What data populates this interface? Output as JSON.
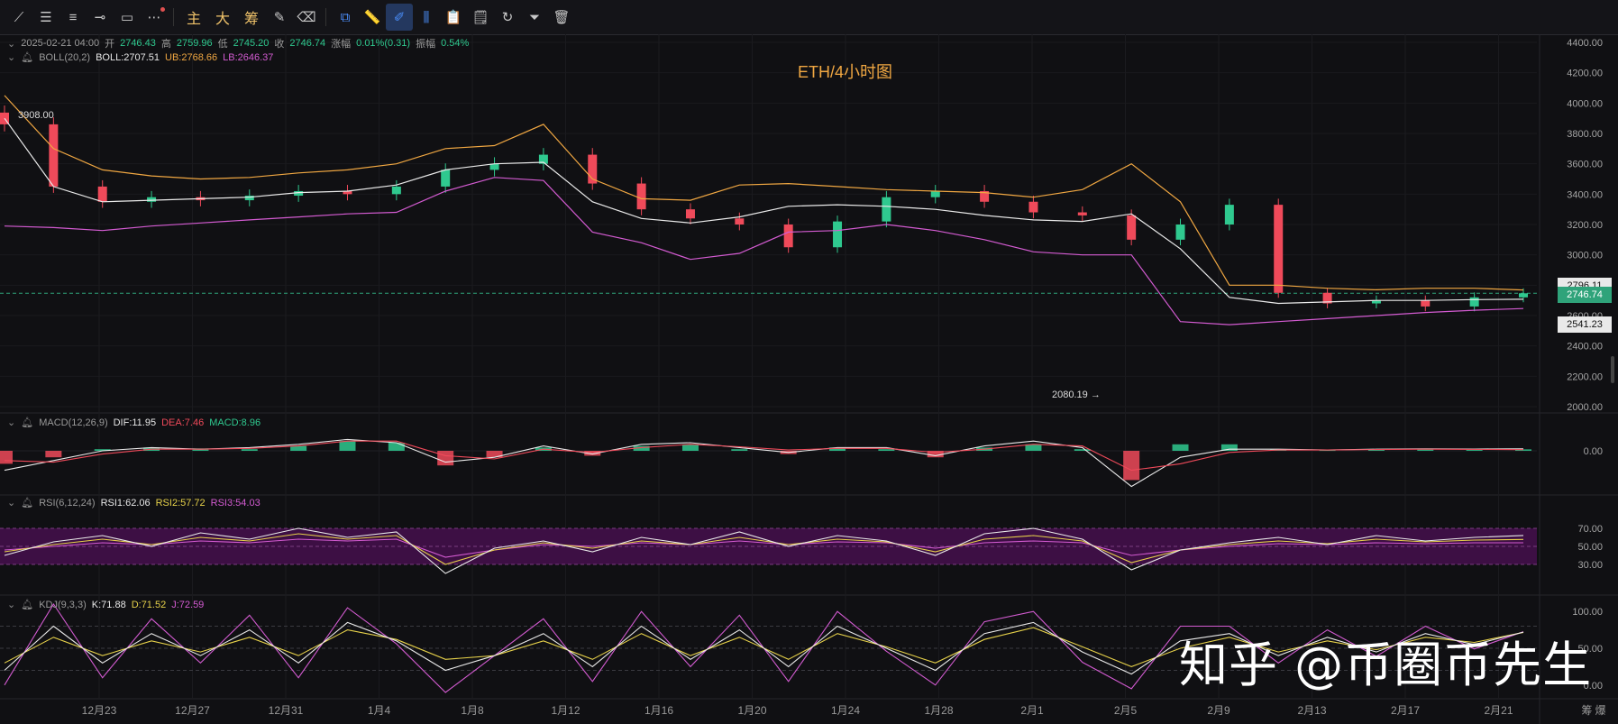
{
  "toolbar": {
    "tools": [
      {
        "name": "trend-line-tool",
        "glyph": "⟋"
      },
      {
        "name": "horizontal-lines-tool",
        "glyph": "☰"
      },
      {
        "name": "parallel-lines-tool",
        "glyph": "≡"
      },
      {
        "name": "horizontal-ray-tool",
        "glyph": "⊸"
      },
      {
        "name": "rectangle-tool",
        "glyph": "▭"
      },
      {
        "name": "more-tools",
        "glyph": "⋯"
      }
    ],
    "cn_buttons": [
      "主",
      "大",
      "筹"
    ],
    "right_tools": [
      {
        "name": "brush-tool",
        "glyph": "✎"
      },
      {
        "name": "eraser-tool",
        "glyph": "⌫"
      },
      {
        "name": "copy-tool",
        "glyph": "⧉"
      },
      {
        "name": "ruler-tool",
        "glyph": "📏"
      },
      {
        "name": "pen-tool",
        "glyph": "✐"
      },
      {
        "name": "candles-tool",
        "glyph": "⫼"
      },
      {
        "name": "clipboard-tool",
        "glyph": "📋"
      },
      {
        "name": "note-tool",
        "glyph": "🗒"
      },
      {
        "name": "replay-tool",
        "glyph": "↻"
      },
      {
        "name": "filter-tool",
        "glyph": "⏷"
      },
      {
        "name": "trash-tool",
        "glyph": "🗑"
      }
    ]
  },
  "ohlc": {
    "datetime": "2025-02-21 04:00",
    "open_label": "开",
    "open": "2746.43",
    "high_label": "高",
    "high": "2759.96",
    "low_label": "低",
    "low": "2745.20",
    "close_label": "收",
    "close": "2746.74",
    "chg_label": "涨幅",
    "chg": "0.01%(0.31)",
    "amp_label": "振幅",
    "amp": "0.54%"
  },
  "boll": {
    "label": "BOLL(20,2)",
    "mid": "BOLL:2707.51",
    "ub": "UB:2768.66",
    "lb": "LB:2646.37"
  },
  "title": "ETH/4小时图",
  "macd_legend": {
    "label": "MACD(12,26,9)",
    "dif": "DIF:11.95",
    "dea": "DEA:7.46",
    "macd": "MACD:8.96"
  },
  "rsi_legend": {
    "label": "RSI(6,12,24)",
    "rsi1": "RSI1:62.06",
    "rsi2": "RSI2:57.72",
    "rsi3": "RSI3:54.03"
  },
  "kdj_legend": {
    "label": "KDJ(9,3,3)",
    "k": "K:71.88",
    "d": "D:71.52",
    "j": "J:72.59"
  },
  "price_tags": {
    "upper": "2796.11",
    "current": "2746.74",
    "lower": "2541.23"
  },
  "annotations": {
    "high": "3908.00",
    "low": "2080.19 →"
  },
  "axis_footer": "筹  爆",
  "watermark": "知乎 @币圈币先生",
  "colors": {
    "up": "#2fc98f",
    "down": "#ef4a5a",
    "ub": "#f0a742",
    "mid": "#eaeaea",
    "lb": "#d35bd1",
    "rsi_band": "#3d0f44"
  },
  "chart_data": [
    {
      "type": "line",
      "name": "price",
      "title": "ETH/4小时图",
      "x_ticks": [
        "12月23",
        "12月27",
        "12月31",
        "1月4",
        "1月8",
        "1月12",
        "1月16",
        "1月20",
        "1月24",
        "1月28",
        "2月1",
        "2月5",
        "2月9",
        "2月13",
        "2月17",
        "2月21"
      ],
      "y_ticks": [
        "4400.00",
        "4200.00",
        "4000.00",
        "3800.00",
        "3600.00",
        "3400.00",
        "3200.00",
        "3000.00",
        "2800.00",
        "2600.00",
        "2400.00",
        "2200.00",
        "2000.00"
      ],
      "ylim": [
        2000,
        4400
      ],
      "x": [
        0,
        2,
        4,
        6,
        8,
        10,
        12,
        14,
        16,
        18,
        20,
        22,
        24,
        26,
        28,
        30,
        32,
        34,
        36,
        38,
        40,
        42,
        44,
        46,
        48,
        50,
        52,
        54,
        56,
        58,
        60,
        62
      ],
      "close": [
        3860,
        3450,
        3350,
        3380,
        3360,
        3390,
        3420,
        3400,
        3450,
        3560,
        3600,
        3660,
        3470,
        3300,
        3240,
        3200,
        3050,
        3220,
        3380,
        3420,
        3350,
        3280,
        3260,
        3100,
        3200,
        3330,
        2750,
        2680,
        2700,
        2660,
        2720,
        2746.74
      ],
      "ub": [
        4050,
        3700,
        3560,
        3520,
        3500,
        3510,
        3540,
        3560,
        3600,
        3700,
        3720,
        3860,
        3500,
        3370,
        3360,
        3460,
        3470,
        3450,
        3430,
        3420,
        3410,
        3380,
        3430,
        3600,
        3350,
        2800,
        2800,
        2780,
        2770,
        2780,
        2780,
        2768.66
      ],
      "mid": [
        3900,
        3450,
        3350,
        3360,
        3370,
        3380,
        3410,
        3420,
        3460,
        3560,
        3600,
        3610,
        3350,
        3240,
        3210,
        3250,
        3320,
        3330,
        3320,
        3300,
        3260,
        3230,
        3220,
        3270,
        3040,
        2720,
        2680,
        2690,
        2700,
        2700,
        2705,
        2707.51
      ],
      "lb": [
        3190,
        3180,
        3160,
        3190,
        3210,
        3230,
        3250,
        3270,
        3280,
        3420,
        3510,
        3490,
        3150,
        3080,
        2970,
        3010,
        3150,
        3160,
        3200,
        3160,
        3100,
        3020,
        3000,
        3000,
        2560,
        2540,
        2560,
        2580,
        2600,
        2620,
        2635,
        2646.37
      ],
      "annotations": [
        "3908.00",
        "2080.19"
      ]
    },
    {
      "type": "bar",
      "name": "MACD(12,26,9)",
      "y_ticks": [
        "0.00"
      ],
      "values": [
        -80,
        -40,
        10,
        20,
        15,
        10,
        30,
        60,
        50,
        -90,
        -40,
        20,
        -30,
        30,
        40,
        10,
        -20,
        20,
        10,
        -40,
        20,
        40,
        10,
        -180,
        40,
        40,
        10,
        5,
        10,
        12,
        8,
        8.96
      ],
      "dif": [
        -120,
        -60,
        0,
        20,
        10,
        20,
        40,
        70,
        50,
        -70,
        -40,
        30,
        -20,
        40,
        50,
        20,
        -10,
        20,
        20,
        -30,
        30,
        60,
        20,
        -220,
        -40,
        10,
        10,
        5,
        10,
        12,
        11,
        11.95
      ],
      "dea": [
        -60,
        -70,
        -20,
        10,
        10,
        15,
        30,
        60,
        60,
        -30,
        -50,
        10,
        -10,
        20,
        40,
        25,
        5,
        15,
        15,
        -10,
        10,
        40,
        30,
        -120,
        -80,
        -10,
        5,
        5,
        8,
        10,
        9,
        7.46
      ],
      "series_names": [
        "DIF",
        "DEA",
        "MACD"
      ]
    },
    {
      "type": "line",
      "name": "RSI(6,12,24)",
      "y_ticks": [
        "70.00",
        "50.00",
        "30.00"
      ],
      "ylim": [
        0,
        100
      ],
      "rsi1": [
        40,
        55,
        62,
        50,
        65,
        58,
        70,
        60,
        66,
        20,
        48,
        56,
        44,
        60,
        52,
        66,
        50,
        62,
        56,
        40,
        64,
        70,
        58,
        24,
        46,
        54,
        60,
        52,
        62,
        56,
        60,
        62.06
      ],
      "rsi2": [
        44,
        52,
        58,
        52,
        60,
        56,
        64,
        58,
        62,
        30,
        46,
        54,
        48,
        56,
        52,
        60,
        52,
        58,
        55,
        44,
        58,
        62,
        56,
        32,
        46,
        52,
        56,
        53,
        58,
        55,
        57,
        57.72
      ],
      "rsi3": [
        46,
        50,
        54,
        52,
        56,
        54,
        58,
        56,
        58,
        38,
        46,
        52,
        50,
        54,
        52,
        56,
        52,
        55,
        54,
        48,
        54,
        56,
        54,
        40,
        46,
        50,
        53,
        52,
        54,
        53,
        54,
        54.03
      ],
      "series_names": [
        "RSI1",
        "RSI2",
        "RSI3"
      ]
    },
    {
      "type": "line",
      "name": "KDJ(9,3,3)",
      "y_ticks": [
        "100.00",
        "50.00",
        "0.00"
      ],
      "ylim": [
        -10,
        110
      ],
      "k": [
        20,
        80,
        30,
        70,
        40,
        75,
        30,
        85,
        60,
        20,
        40,
        70,
        25,
        80,
        35,
        75,
        25,
        80,
        50,
        20,
        70,
        85,
        45,
        15,
        60,
        70,
        40,
        65,
        45,
        70,
        55,
        71.88
      ],
      "d": [
        30,
        65,
        40,
        60,
        45,
        65,
        40,
        75,
        62,
        35,
        40,
        60,
        35,
        70,
        40,
        65,
        35,
        70,
        52,
        30,
        62,
        78,
        52,
        25,
        50,
        65,
        45,
        60,
        48,
        65,
        58,
        71.52
      ],
      "j": [
        0,
        110,
        10,
        90,
        30,
        95,
        10,
        105,
        56,
        -10,
        40,
        90,
        5,
        100,
        25,
        95,
        5,
        100,
        46,
        0,
        86,
        100,
        31,
        -5,
        80,
        80,
        30,
        75,
        39,
        80,
        49,
        72.59
      ],
      "series_names": [
        "K",
        "D",
        "J"
      ]
    }
  ]
}
